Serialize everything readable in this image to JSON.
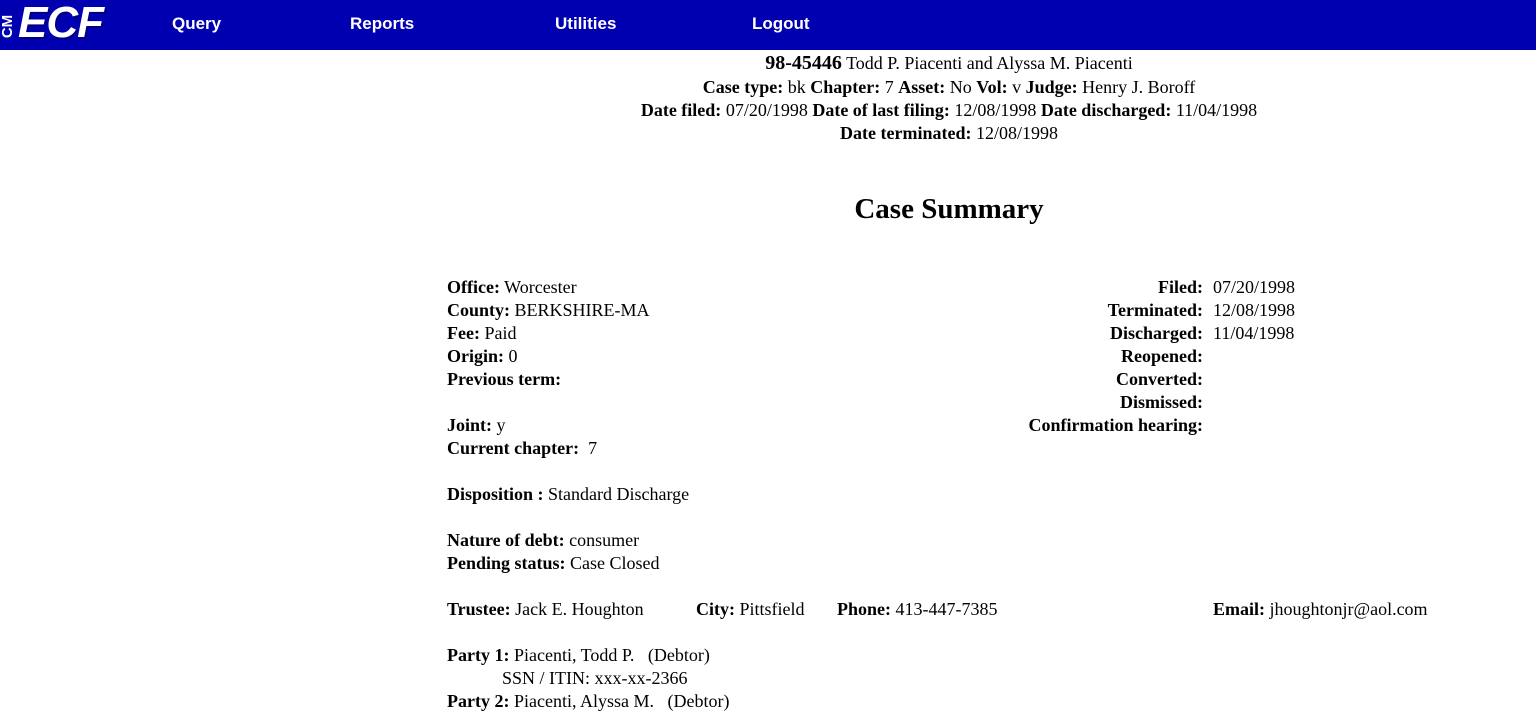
{
  "nav": {
    "logo_cm": "CM",
    "logo_ecf": "ECF",
    "items": [
      "Query",
      "Reports",
      "Utilities",
      "Logout"
    ]
  },
  "case_header": {
    "number": "98-45446",
    "parties": "Todd P. Piacenti and Alyssa M. Piacenti",
    "case_type_label": "Case type:",
    "case_type": "bk",
    "chapter_label": "Chapter:",
    "chapter": "7",
    "asset_label": "Asset:",
    "asset": "No",
    "vol_label": "Vol:",
    "vol": "v",
    "judge_label": "Judge:",
    "judge": "Henry J. Boroff",
    "date_filed_label": "Date filed:",
    "date_filed": "07/20/1998",
    "date_last_filing_label": "Date of last filing:",
    "date_last_filing": "12/08/1998",
    "date_discharged_label": "Date discharged:",
    "date_discharged": "11/04/1998",
    "date_terminated_label": "Date terminated:",
    "date_terminated": "12/08/1998"
  },
  "title": "Case Summary",
  "left": {
    "office_label": "Office:",
    "office": "Worcester",
    "county_label": "County:",
    "county": "BERKSHIRE-MA",
    "fee_label": "Fee:",
    "fee": "Paid",
    "origin_label": "Origin:",
    "origin": "0",
    "previous_term_label": "Previous term:",
    "joint_label": "Joint:",
    "joint": "y",
    "current_chapter_label": "Current chapter:",
    "current_chapter": "7",
    "disposition_label": "Disposition :",
    "disposition": "Standard Discharge",
    "nature_label": "Nature of debt:",
    "nature": "consumer",
    "pending_label": "Pending status:",
    "pending": "Case Closed"
  },
  "right": {
    "filed_label": "Filed:",
    "filed": "07/20/1998",
    "terminated_label": "Terminated:",
    "terminated": "12/08/1998",
    "discharged_label": "Discharged:",
    "discharged": "11/04/1998",
    "reopened_label": "Reopened:",
    "converted_label": "Converted:",
    "dismissed_label": "Dismissed:",
    "confirmation_label": "Confirmation hearing:"
  },
  "trustee": {
    "trustee_label": "Trustee:",
    "trustee": "Jack E. Houghton",
    "city_label": "City:",
    "city": "Pittsfield",
    "phone_label": "Phone:",
    "phone": "413-447-7385",
    "email_label": "Email:",
    "email": "jhoughtonjr@aol.com"
  },
  "parties": {
    "party1_label": "Party 1:",
    "party1": "Piacenti, Todd P.",
    "party1_role": "(Debtor)",
    "party1_ssn": "SSN / ITIN: xxx-xx-2366",
    "party2_label": "Party 2:",
    "party2": "Piacenti, Alyssa M.",
    "party2_role": "(Debtor)"
  }
}
